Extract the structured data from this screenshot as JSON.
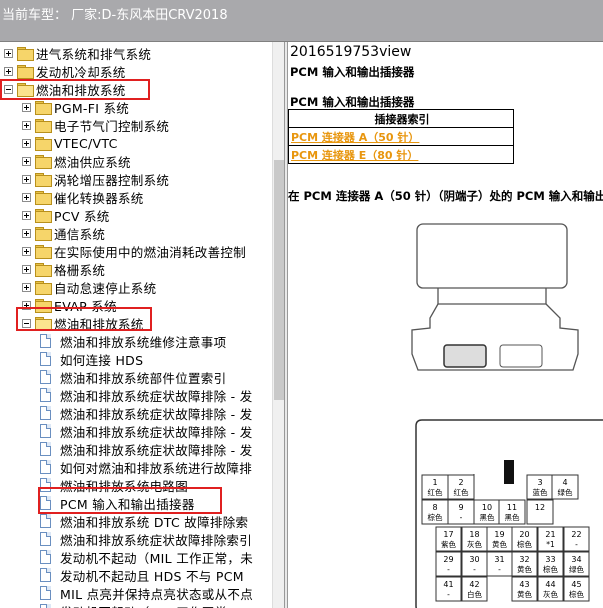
{
  "topbar": {
    "title": "当前车型：   厂家:D-东风本田CRV2018"
  },
  "tree": {
    "items": [
      {
        "label": "进气系统和排气系统",
        "type": "folder",
        "expand": "plus"
      },
      {
        "label": "发动机冷却系统",
        "type": "folder",
        "expand": "plus"
      },
      {
        "label": "燃油和排放系统",
        "type": "folder",
        "expand": "minus"
      },
      {
        "label": "PGM-FI 系统",
        "type": "folder",
        "expand": "plus"
      },
      {
        "label": "电子节气门控制系统",
        "type": "folder",
        "expand": "plus"
      },
      {
        "label": "VTEC/VTC",
        "type": "folder",
        "expand": "plus"
      },
      {
        "label": "燃油供应系统",
        "type": "folder",
        "expand": "plus"
      },
      {
        "label": "涡轮增压器控制系统",
        "type": "folder",
        "expand": "plus"
      },
      {
        "label": "催化转换器系统",
        "type": "folder",
        "expand": "plus"
      },
      {
        "label": "PCV 系统",
        "type": "folder",
        "expand": "plus"
      },
      {
        "label": "通信系统",
        "type": "folder",
        "expand": "plus"
      },
      {
        "label": "在实际使用中的燃油消耗改善控制",
        "type": "folder",
        "expand": "plus"
      },
      {
        "label": "格栅系统",
        "type": "folder",
        "expand": "plus"
      },
      {
        "label": "自动怠速停止系统",
        "type": "folder",
        "expand": "plus"
      },
      {
        "label": "EVAP 系统",
        "type": "folder",
        "expand": "plus"
      },
      {
        "label": "燃油和排放系统",
        "type": "folder",
        "expand": "minus"
      },
      {
        "label": "燃油和排放系统维修注意事项",
        "type": "doc"
      },
      {
        "label": "如何连接 HDS",
        "type": "doc"
      },
      {
        "label": "燃油和排放系统部件位置索引",
        "type": "doc"
      },
      {
        "label": "燃油和排放系统症状故障排除 - 发",
        "type": "doc"
      },
      {
        "label": "燃油和排放系统症状故障排除 - 发",
        "type": "doc"
      },
      {
        "label": "燃油和排放系统症状故障排除 - 发",
        "type": "doc"
      },
      {
        "label": "燃油和排放系统症状故障排除 - 发",
        "type": "doc"
      },
      {
        "label": "如何对燃油和排放系统进行故障排",
        "type": "doc"
      },
      {
        "label": "燃油和排放系统电路图",
        "type": "doc"
      },
      {
        "label": "PCM 输入和输出插接器",
        "type": "doc"
      },
      {
        "label": "燃油和排放系统 DTC 故障排除索",
        "type": "doc"
      },
      {
        "label": "燃油和排放系统症状故障排除索引",
        "type": "doc"
      },
      {
        "label": "发动机不起动（MIL 工作正常，未",
        "type": "doc"
      },
      {
        "label": "发动机不起动且 HDS 不与 PCM",
        "type": "doc"
      },
      {
        "label": "MIL 点亮并保持点亮状态或从不点",
        "type": "doc"
      },
      {
        "label": "发动机不起动（MIL 工作正常，D",
        "type": "doc"
      }
    ]
  },
  "content": {
    "doc_id": "2016519753view",
    "heading1": "PCM 输入和输出插接器",
    "heading2": "PCM 输入和输出插接器",
    "index_table": {
      "header": "插接器索引",
      "links": [
        "PCM 连接器 A（50 针）",
        "PCM 连接器 E（80 针）"
      ]
    },
    "section_title": "在 PCM 连接器 A（50 针）（阴端子）处的 PCM 输入和输出",
    "pins": [
      {
        "n": "1",
        "c": "红色"
      },
      {
        "n": "2",
        "c": "红色"
      },
      {
        "n": "3",
        "c": "蓝色"
      },
      {
        "n": "4",
        "c": "绿色"
      },
      {
        "n": "8",
        "c": "棕色"
      },
      {
        "n": "9",
        "c": "-"
      },
      {
        "n": "10",
        "c": "黑色"
      },
      {
        "n": "11",
        "c": "黑色"
      },
      {
        "n": "12",
        "c": ""
      },
      {
        "n": "17",
        "c": "紫色"
      },
      {
        "n": "18",
        "c": "灰色"
      },
      {
        "n": "19",
        "c": "黄色"
      },
      {
        "n": "20",
        "c": "棕色"
      },
      {
        "n": "21",
        "c": "*1"
      },
      {
        "n": "22",
        "c": "-"
      },
      {
        "n": "29",
        "c": "-"
      },
      {
        "n": "30",
        "c": "-"
      },
      {
        "n": "31",
        "c": "-"
      },
      {
        "n": "32",
        "c": "黄色"
      },
      {
        "n": "33",
        "c": "棕色"
      },
      {
        "n": "34",
        "c": "绿色"
      },
      {
        "n": "41",
        "c": "-"
      },
      {
        "n": "42",
        "c": "白色"
      },
      {
        "n": "43",
        "c": "黄色"
      },
      {
        "n": "44",
        "c": "灰色"
      },
      {
        "n": "45",
        "c": "棕色"
      }
    ]
  },
  "colors": {
    "highlight": "#e02020",
    "link": "#e8960e",
    "topbar": "#a9a9ac"
  }
}
